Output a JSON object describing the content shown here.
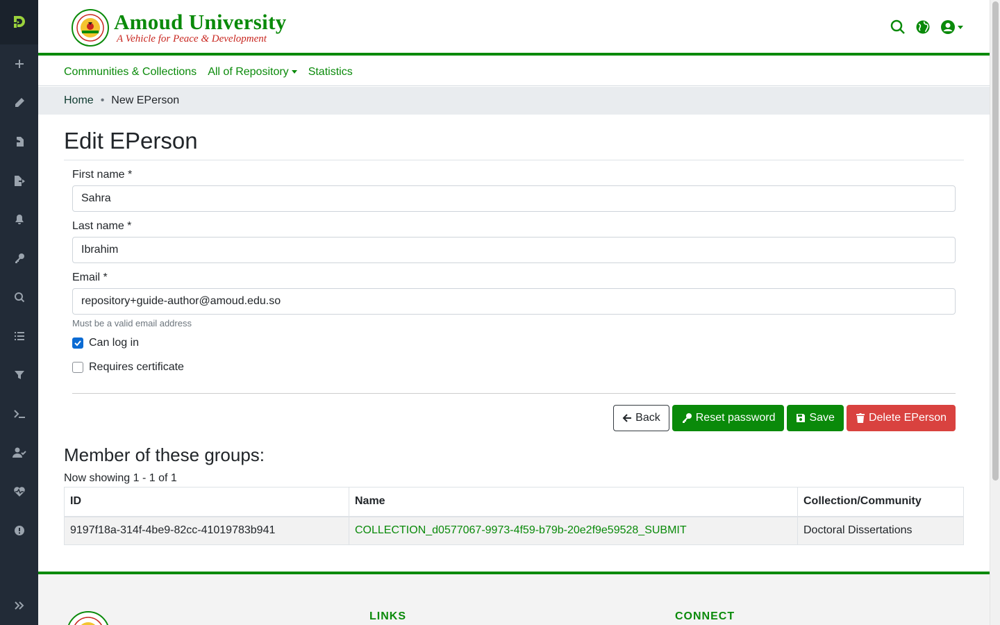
{
  "brand": {
    "name": "Amoud University",
    "tagline": "A Vehicle for Peace & Development",
    "colors": {
      "primary": "#0a8a0a",
      "accent": "#c8261f"
    }
  },
  "sidebar": {
    "items": [
      {
        "icon": "plus-icon",
        "label": "New"
      },
      {
        "icon": "pencil-icon",
        "label": "Edit"
      },
      {
        "icon": "file-import-icon",
        "label": "Import"
      },
      {
        "icon": "file-export-icon",
        "label": "Export"
      },
      {
        "icon": "bell-icon",
        "label": "Notifications"
      },
      {
        "icon": "key-icon",
        "label": "Access Control"
      },
      {
        "icon": "search-icon",
        "label": "Admin Search"
      },
      {
        "icon": "list-icon",
        "label": "Registries"
      },
      {
        "icon": "filter-icon",
        "label": "Curation Task"
      },
      {
        "icon": "terminal-icon",
        "label": "Processes"
      },
      {
        "icon": "user-check-icon",
        "label": "Workflow"
      },
      {
        "icon": "heartbeat-icon",
        "label": "Health"
      },
      {
        "icon": "info-icon",
        "label": "System-wide Alert"
      }
    ],
    "expand_icon": "chevrons-right-icon"
  },
  "header": {
    "icons": [
      "search-icon",
      "globe-icon",
      "user-circle-icon"
    ]
  },
  "nav": {
    "communities": "Communities & Collections",
    "all_repository": "All of Repository",
    "statistics": "Statistics"
  },
  "breadcrumb": {
    "home": "Home",
    "current": "New EPerson"
  },
  "form": {
    "title": "Edit EPerson",
    "first_name_label": "First name *",
    "first_name_value": "Sahra",
    "last_name_label": "Last name *",
    "last_name_value": "Ibrahim",
    "email_label": "Email *",
    "email_value": "repository+guide-author@amoud.edu.so",
    "email_help": "Must be a valid email address",
    "can_login_label": "Can log in",
    "can_login_checked": true,
    "requires_cert_label": "Requires certificate",
    "requires_cert_checked": false
  },
  "actions": {
    "back": "Back",
    "reset_password": "Reset password",
    "save": "Save",
    "delete": "Delete EPerson"
  },
  "groups": {
    "title": "Member of these groups:",
    "showing": "Now showing 1 - 1 of 1",
    "columns": [
      "ID",
      "Name",
      "Collection/Community"
    ],
    "rows": [
      {
        "id": "9197f18a-314f-4be9-82cc-41019783b941",
        "name": "COLLECTION_d0577067-9973-4f59-b79b-20e2f9e59528_SUBMIT",
        "collection": "Doctoral Dissertations"
      }
    ]
  },
  "footer": {
    "links": "LINKS",
    "connect": "CONNECT"
  }
}
